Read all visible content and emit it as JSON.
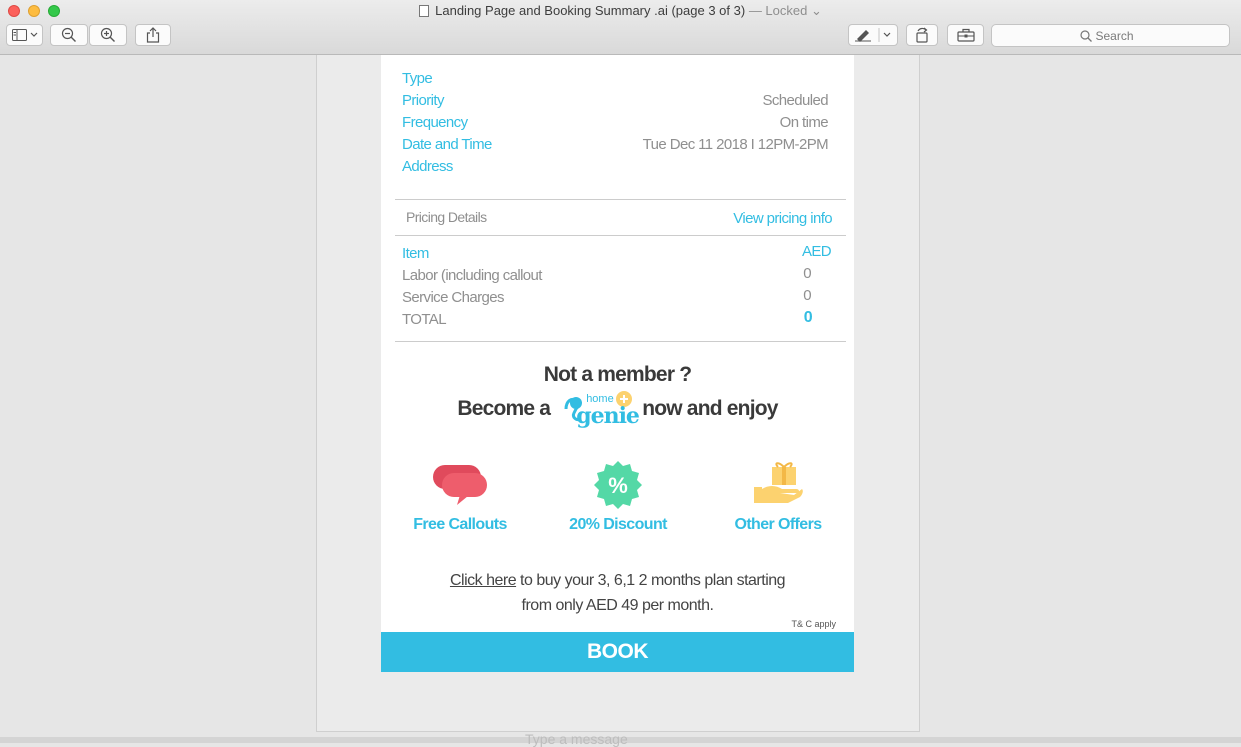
{
  "window": {
    "title": "Landing Page and Booking Summary .ai (page 3 of 3)",
    "status": "— Locked ⌄"
  },
  "toolbar": {
    "search_placeholder": "Search"
  },
  "details": {
    "rows": [
      {
        "label": "Type",
        "value": ""
      },
      {
        "label": "Priority",
        "value": "Scheduled"
      },
      {
        "label": "Frequency",
        "value": "On time"
      },
      {
        "label": "Date and Time",
        "value": "Tue Dec 11 2018 I 12PM-2PM"
      },
      {
        "label": "Address",
        "value": ""
      }
    ]
  },
  "pricing": {
    "header_label": "Pricing Details",
    "view_link": "View pricing info",
    "item_label": "Item",
    "currency": "AED",
    "rows": [
      {
        "label": "Labor (including callout",
        "value": "0"
      },
      {
        "label": "Service Charges",
        "value": "0"
      }
    ],
    "total_label": "TOTAL",
    "total_value": "0"
  },
  "membership": {
    "line1": "Not a member ?",
    "line2_before": "Become a",
    "logo_top": "home",
    "logo_bottom": "genie",
    "line2_after": "now and enjoy",
    "benefits": [
      {
        "label": "Free Callouts",
        "icon": "chat-bubbles-icon"
      },
      {
        "label": "20% Discount",
        "icon": "percent-badge-icon"
      },
      {
        "label": "Other Offers",
        "icon": "gift-hand-icon"
      }
    ],
    "promo_link": "Click here",
    "promo_text_1": " to buy your 3, 6,1 2 months plan starting",
    "promo_text_2": "from only AED 49 per month.",
    "terms": "T& C apply"
  },
  "book_button": "BOOK",
  "underlay_text": "Type a message",
  "colors": {
    "accent": "#32bde2",
    "benefit_red": "#ee5d6c",
    "benefit_green": "#54d8a6",
    "benefit_yellow": "#fcd26f"
  }
}
